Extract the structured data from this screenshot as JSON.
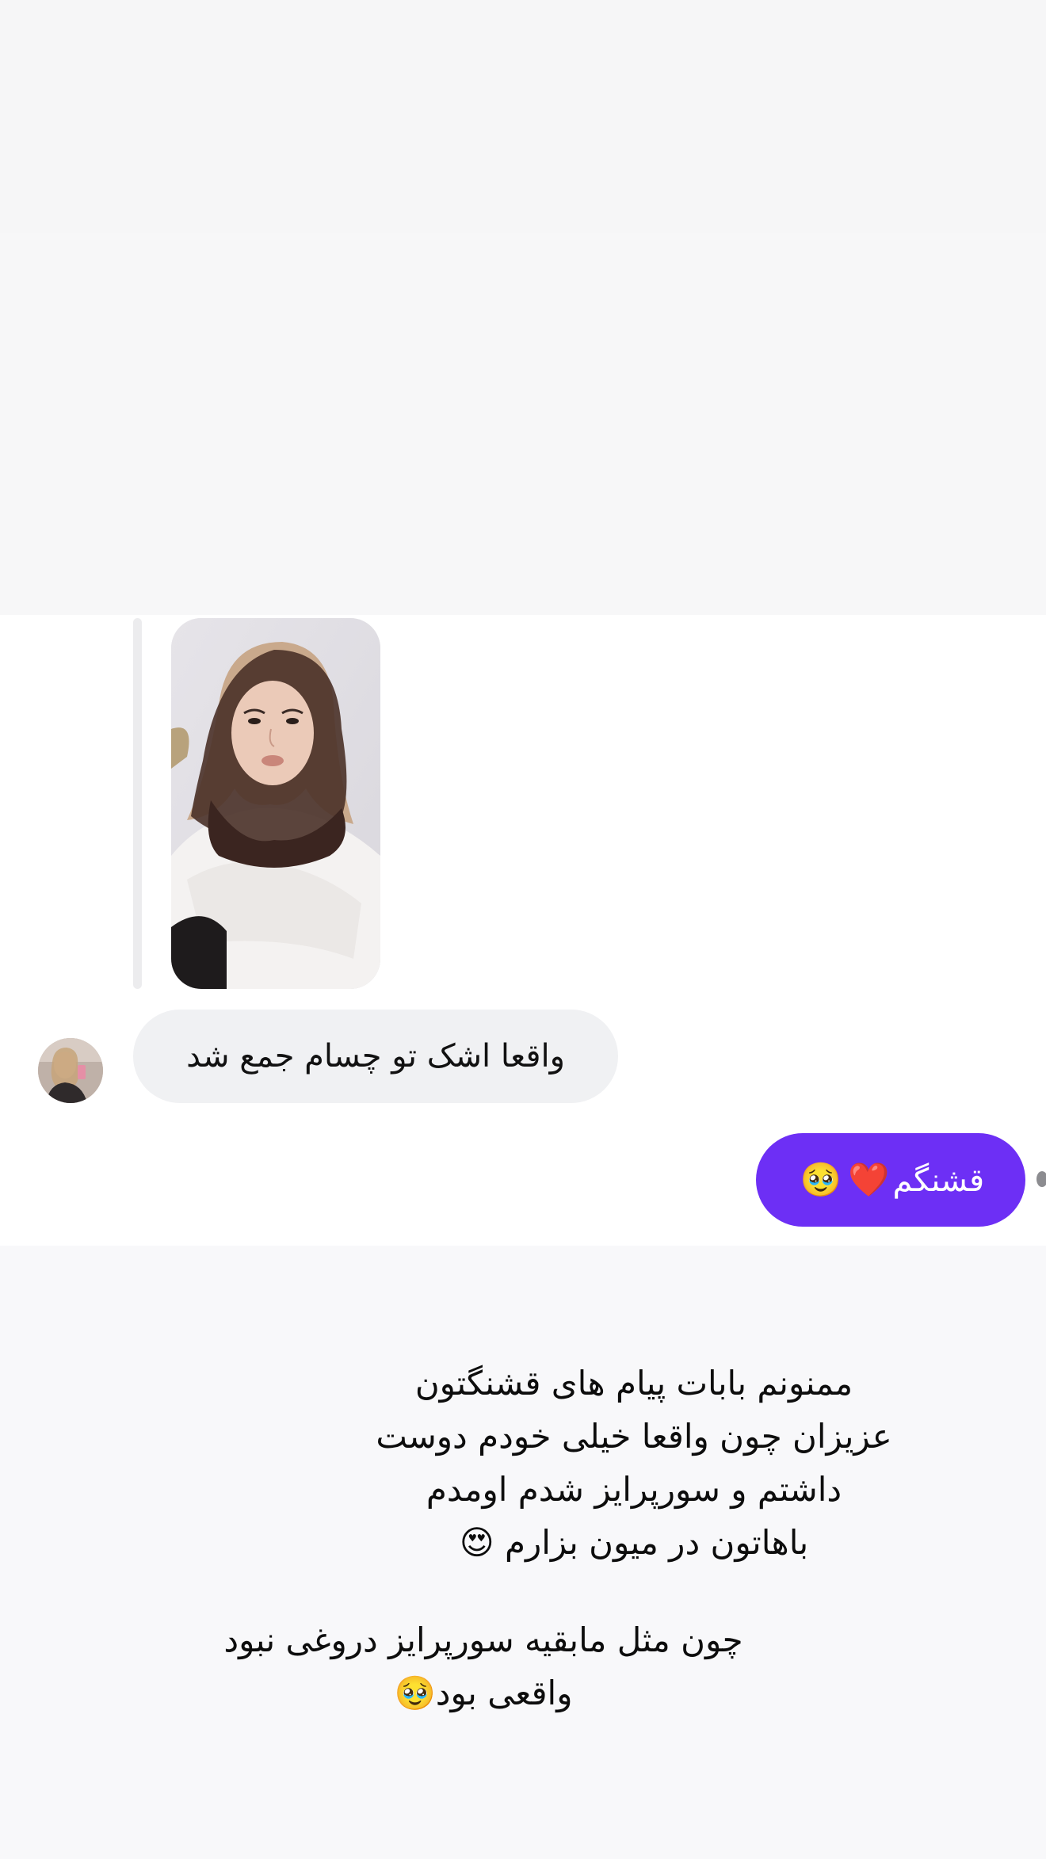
{
  "conversation": {
    "story_reply": {
      "thumbnail_icon": "story-video-thumbnail"
    },
    "incoming_message": {
      "text": "واقعا اشک تو چسام جمع شد",
      "sender_avatar_icon": "profile-avatar"
    },
    "outgoing_message": {
      "text": "قشنگم",
      "emoji_heart": "❤️",
      "emoji_pleading": "🥹",
      "bubble_color": "#6d2ff5"
    }
  },
  "caption": {
    "paragraph_1": [
      "ممنونم بابات پیام های قشنگتون",
      "عزیزان چون واقعا خیلی خودم دوست",
      "داشتم و سورپرایز شدم اومدم",
      "باهاتون در میون بزارم 😍"
    ],
    "paragraph_2": [
      "چون مثل مابقیه سورپرایز دروغی نبود",
      "واقعی بود🥹"
    ]
  },
  "colors": {
    "incoming_bubble": "#f0f1f3",
    "caption_band": "#f8f8fa"
  }
}
